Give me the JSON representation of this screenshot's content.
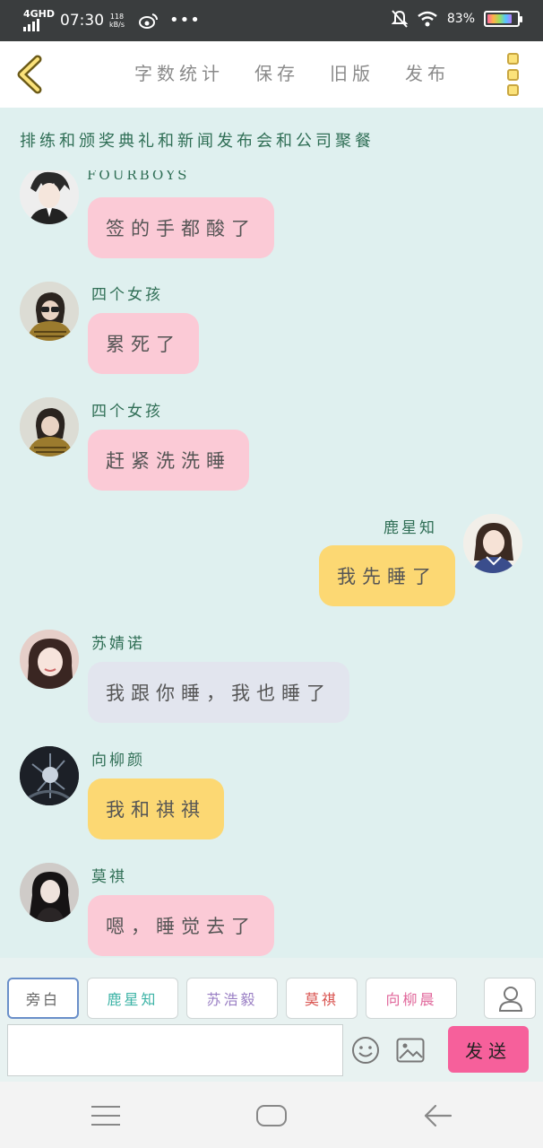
{
  "status_bar": {
    "network": "4GHD",
    "time": "07:30",
    "speed": "118",
    "speed_unit": "kB/s",
    "battery": "83%",
    "icons": [
      "weibo-icon",
      "more-dots-icon",
      "mute-icon",
      "wifi-icon",
      "battery-icon"
    ]
  },
  "toolbar": {
    "menu": [
      "字数统计",
      "保存",
      "旧版",
      "发布"
    ]
  },
  "title": "排练和颁奖典礼和新闻发布会和公司聚餐",
  "messages": [
    {
      "sender": "FOURBOYS",
      "text": "签的手都酸了",
      "side": "left",
      "color": "pink"
    },
    {
      "sender": "四个女孩",
      "text": "累死了",
      "side": "left",
      "color": "pink"
    },
    {
      "sender": "四个女孩",
      "text": "赶紧洗洗睡",
      "side": "left",
      "color": "pink"
    },
    {
      "sender": "鹿星知",
      "text": "我先睡了",
      "side": "right",
      "color": "yellow"
    },
    {
      "sender": "苏婧诺",
      "text": "我跟你睡，我也睡了",
      "side": "left",
      "color": "gray"
    },
    {
      "sender": "向柳颜",
      "text": "我和祺祺",
      "side": "left",
      "color": "yellow"
    },
    {
      "sender": "莫祺",
      "text": "嗯，睡觉去了",
      "side": "left",
      "color": "pink"
    }
  ],
  "character_tabs": [
    {
      "label": "旁白",
      "color": "#666666"
    },
    {
      "label": "鹿星知",
      "color": "#3db3a6"
    },
    {
      "label": "苏浩毅",
      "color": "#9a7fc4"
    },
    {
      "label": "莫祺",
      "color": "#d9534f"
    },
    {
      "label": "向柳晨",
      "color": "#e0669a"
    }
  ],
  "input": {
    "value": "",
    "placeholder": ""
  },
  "send_label": "发送",
  "colors": {
    "background": "#dff0ef",
    "pink_bubble": "#fbcad6",
    "yellow_bubble": "#fcd873",
    "gray_bubble": "#e2e5ee",
    "send_button": "#f6609b",
    "accent": "#2f6e55"
  }
}
